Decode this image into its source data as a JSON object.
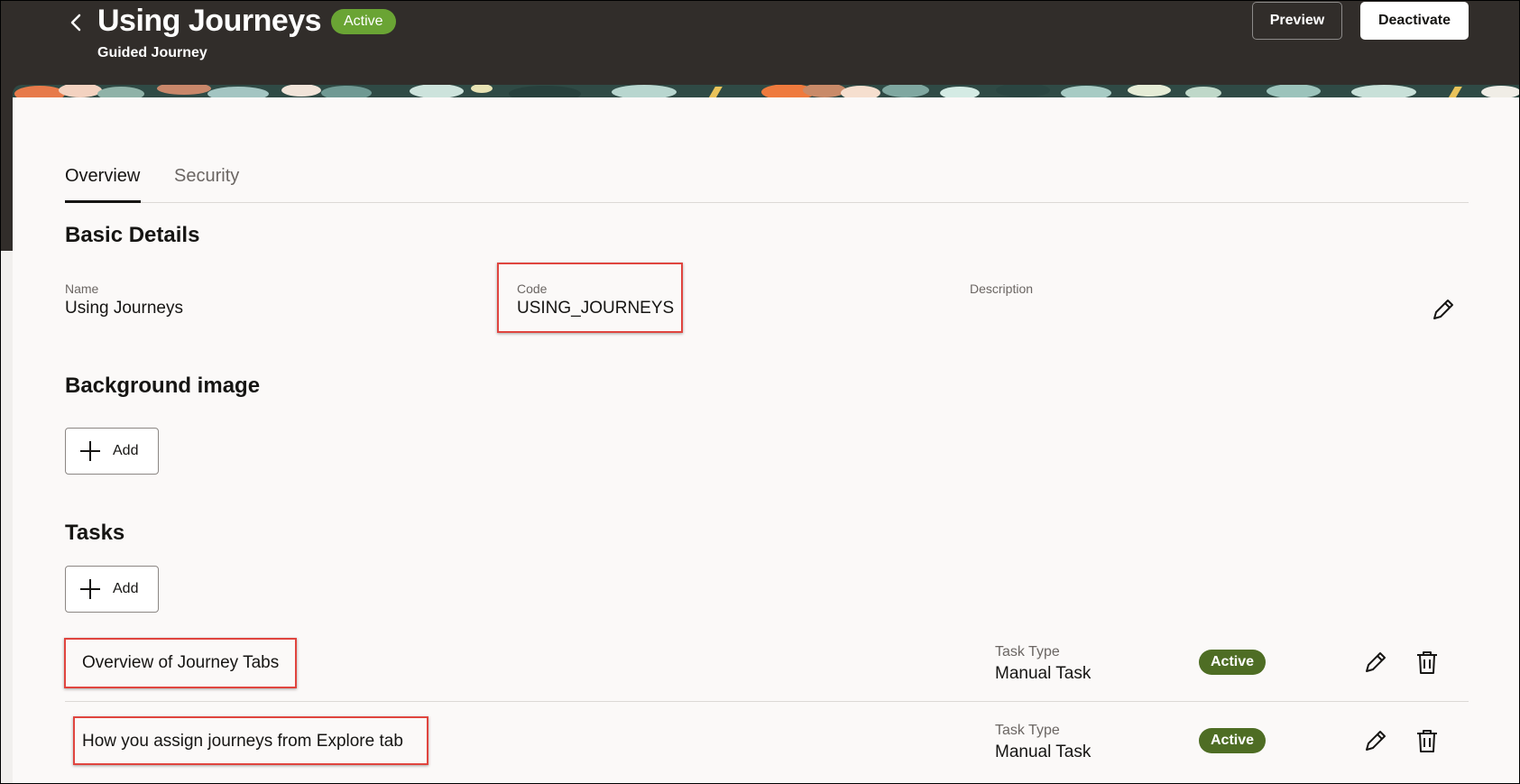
{
  "header": {
    "title": "Using Journeys",
    "status_badge": "Active",
    "subtitle": "Guided Journey",
    "preview_label": "Preview",
    "deactivate_label": "Deactivate",
    "back_icon": "chevron-left-icon"
  },
  "tabs": [
    {
      "label": "Overview",
      "selected": true
    },
    {
      "label": "Security",
      "selected": false
    }
  ],
  "basic_details": {
    "title": "Basic Details",
    "name_label": "Name",
    "name_value": "Using Journeys",
    "code_label": "Code",
    "code_value": "USING_JOURNEYS",
    "description_label": "Description",
    "edit_icon": "pencil-icon"
  },
  "background_image": {
    "title": "Background image",
    "add_label": "Add"
  },
  "tasks": {
    "title": "Tasks",
    "add_label": "Add",
    "items": [
      {
        "title": "Overview of Journey Tabs",
        "type_label": "Task Type",
        "type_value": "Manual Task",
        "status": "Active"
      },
      {
        "title": "How you assign journeys from Explore tab",
        "type_label": "Task Type",
        "type_value": "Manual Task",
        "status": "Active"
      }
    ]
  },
  "colors": {
    "header_bg": "#312d2a",
    "page_bg": "#fbf9f8",
    "active_badge_header": "#6aa434",
    "active_badge_task": "#4e6d24",
    "highlight_box": "#e0453f"
  }
}
